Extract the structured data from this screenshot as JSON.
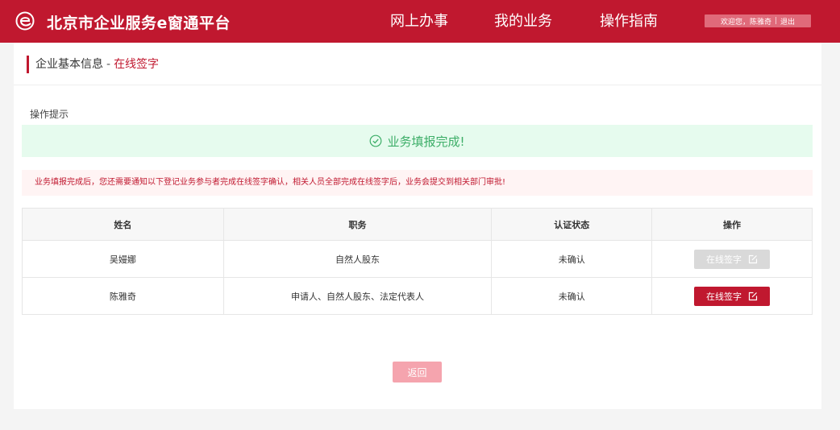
{
  "header": {
    "brand": "北京市企业服务e窗通平台",
    "logo_icon": "e-logo-icon",
    "nav": [
      {
        "label": "网上办事"
      },
      {
        "label": "我的业务"
      },
      {
        "label": "操作指南"
      }
    ],
    "user": {
      "welcome": "欢迎您，陈雅奇",
      "logout": "退出"
    }
  },
  "breadcrumb": {
    "parent": "企业基本信息",
    "separator": "-",
    "current": "在线签字"
  },
  "tip": {
    "title": "操作提示",
    "success_icon": "check-circle-icon",
    "success_message": "业务填报完成!",
    "notice": "业务填报完成后，您还需要通知以下登记业务参与者完成在线签字确认，相关人员全部完成在线签字后，业务会提交到相关部门审批!"
  },
  "table": {
    "columns": [
      "姓名",
      "职务",
      "认证状态",
      "操作"
    ],
    "rows": [
      {
        "name": "吴嫚娜",
        "role": "自然人股东",
        "status": "未确认",
        "action": "在线签字",
        "action_enabled": false
      },
      {
        "name": "陈雅奇",
        "role": "申请人、自然人股东、法定代表人",
        "status": "未确认",
        "action": "在线签字",
        "action_enabled": true
      }
    ]
  },
  "back_label": "返回",
  "colors": {
    "brand_red": "#c0182f",
    "success_green": "#3dae68",
    "success_bg": "#e6fbee",
    "notice_bg": "#fff4f4",
    "disabled_btn": "#d9d9d9",
    "back_btn": "#f5a4ae"
  }
}
